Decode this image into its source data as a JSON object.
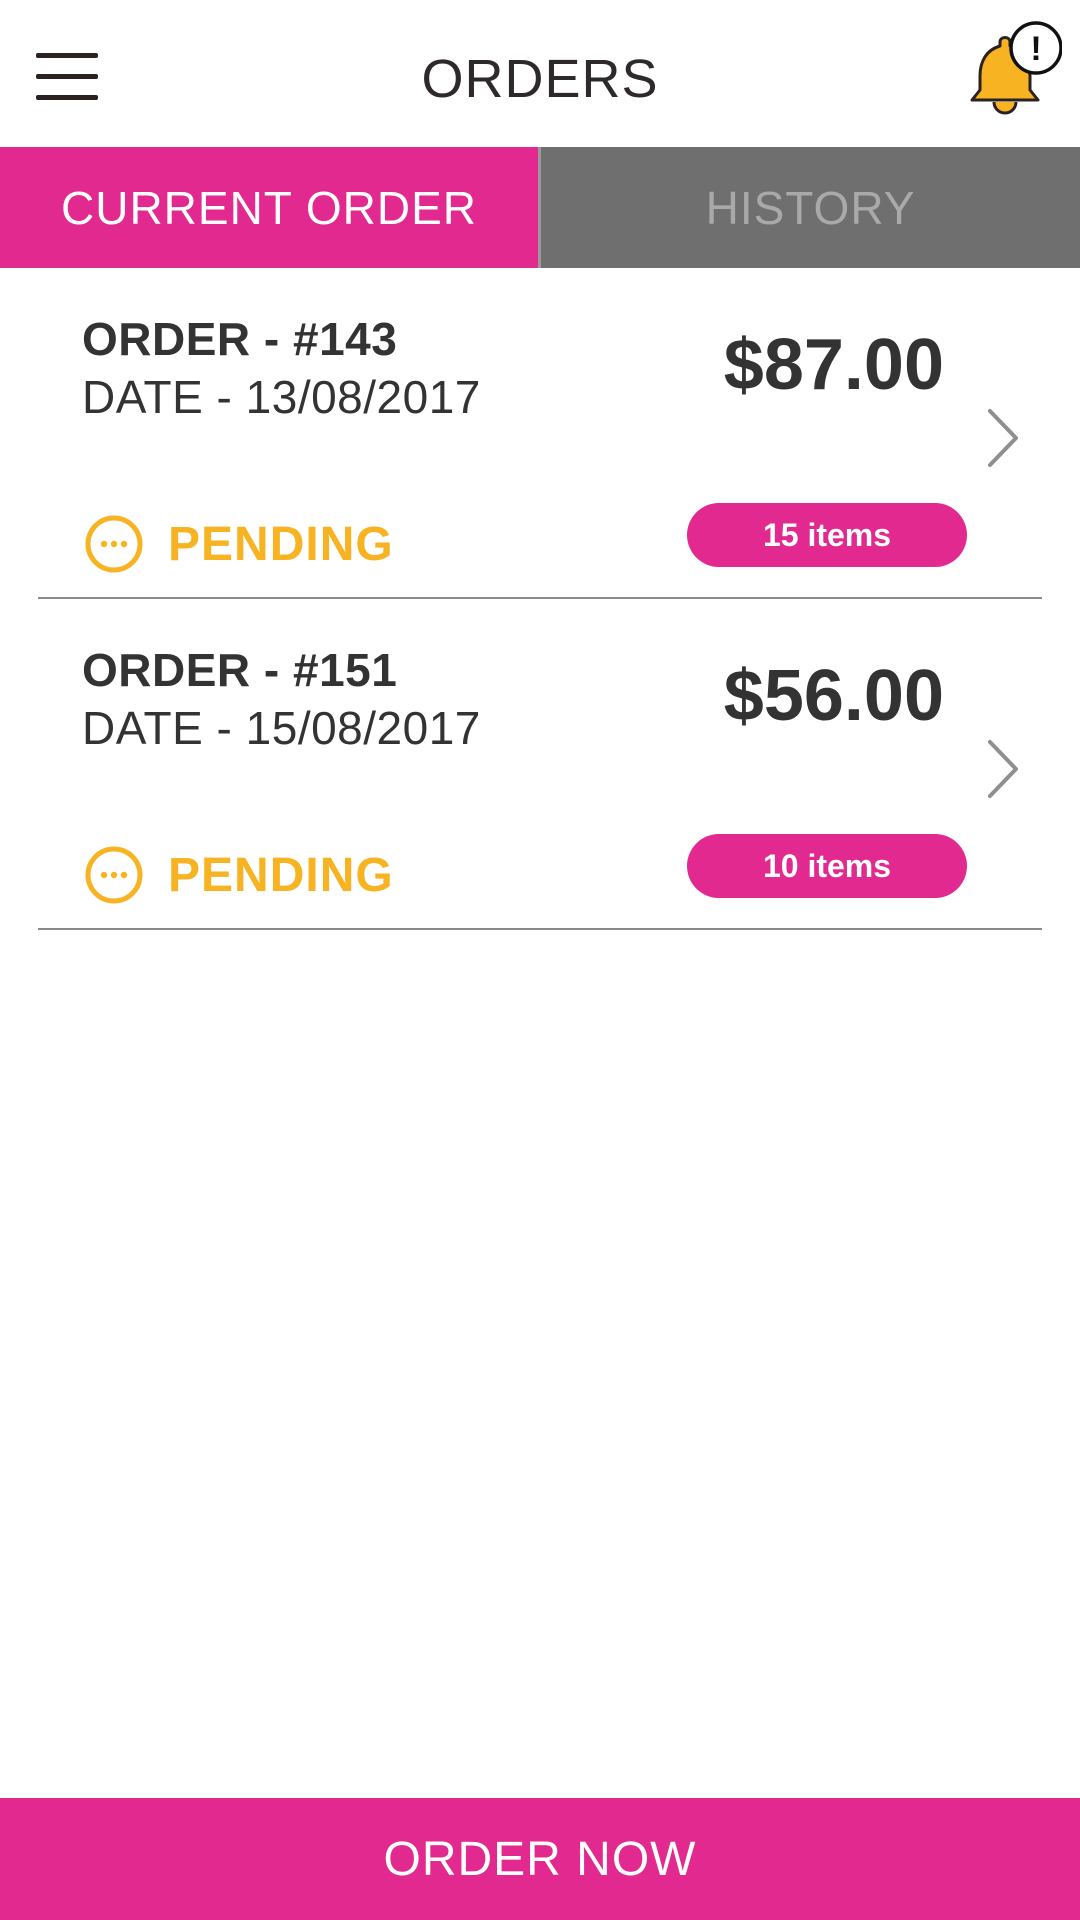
{
  "header": {
    "title": "ORDERS",
    "notification_badge": "!"
  },
  "tabs": [
    {
      "label": "CURRENT ORDER",
      "active": true
    },
    {
      "label": "HISTORY",
      "active": false
    }
  ],
  "orders": [
    {
      "number": "ORDER - #143",
      "date": "DATE - 13/08/2017",
      "amount": "$87.00",
      "status": "PENDING",
      "items": "15 items"
    },
    {
      "number": "ORDER - #151",
      "date": "DATE - 15/08/2017",
      "amount": "$56.00",
      "status": "PENDING",
      "items": "10 items"
    }
  ],
  "footer": {
    "cta_label": "ORDER NOW"
  },
  "colors": {
    "accent": "#e22990",
    "tab_inactive": "#6f6f6f",
    "pending": "#f7b322",
    "bell": "#f7b322",
    "text": "#333333"
  },
  "icons": {
    "menu": "hamburger-menu-icon",
    "notification": "bell-icon",
    "status": "pending-dots-icon",
    "chevron": "chevron-right-icon"
  }
}
